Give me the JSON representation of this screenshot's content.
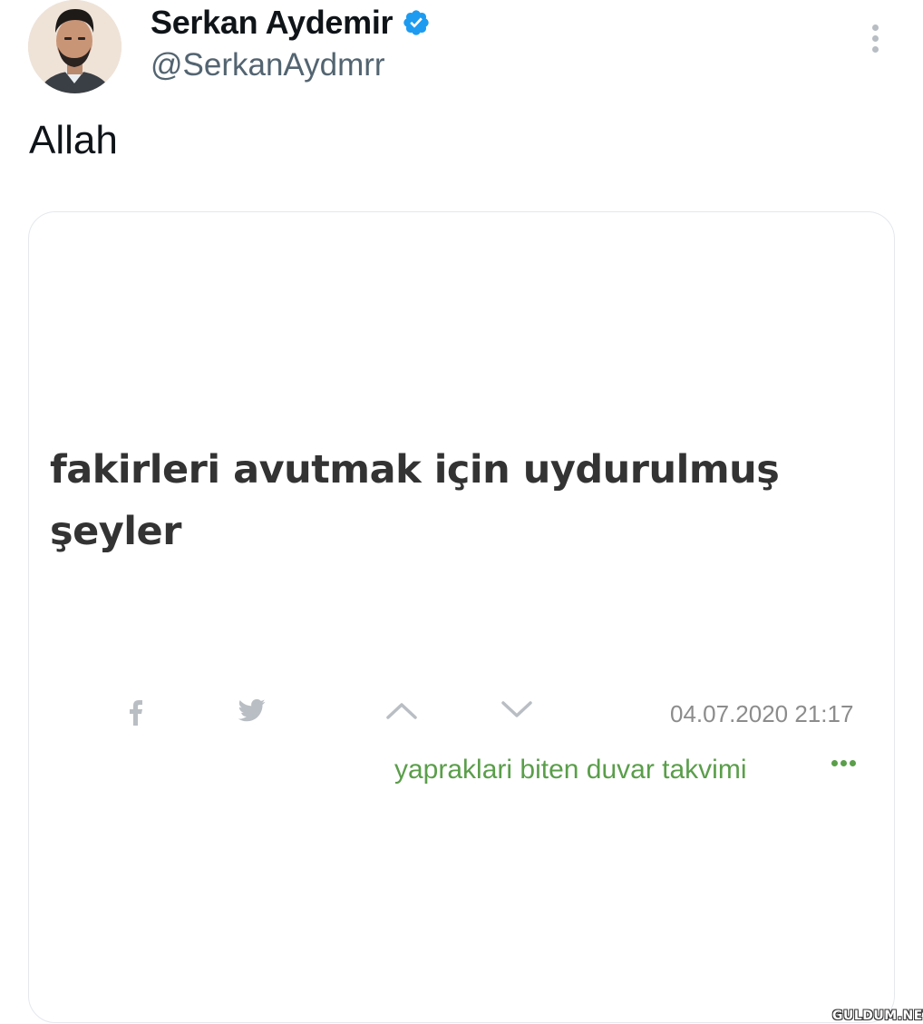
{
  "tweet": {
    "display_name": "Serkan Aydemir",
    "handle": "@SerkanAydmrr",
    "verified": true,
    "text": "Allah"
  },
  "card": {
    "quote_line1": "fakirleri avutmak için uydurulmuş",
    "quote_line2": "şeyler",
    "icons": [
      "facebook-icon",
      "twitter-icon",
      "upvote-chevron-icon",
      "downvote-chevron-icon",
      "more-dots-icon"
    ],
    "date": "04.07.2020 21:17",
    "author": "yapraklari biten duvar takvimi"
  },
  "colors": {
    "verified_blue": "#1d9bf0",
    "author_green": "#5a9e4a",
    "icon_gray": "#b9bec4"
  },
  "watermark": "GULDUM.NET"
}
